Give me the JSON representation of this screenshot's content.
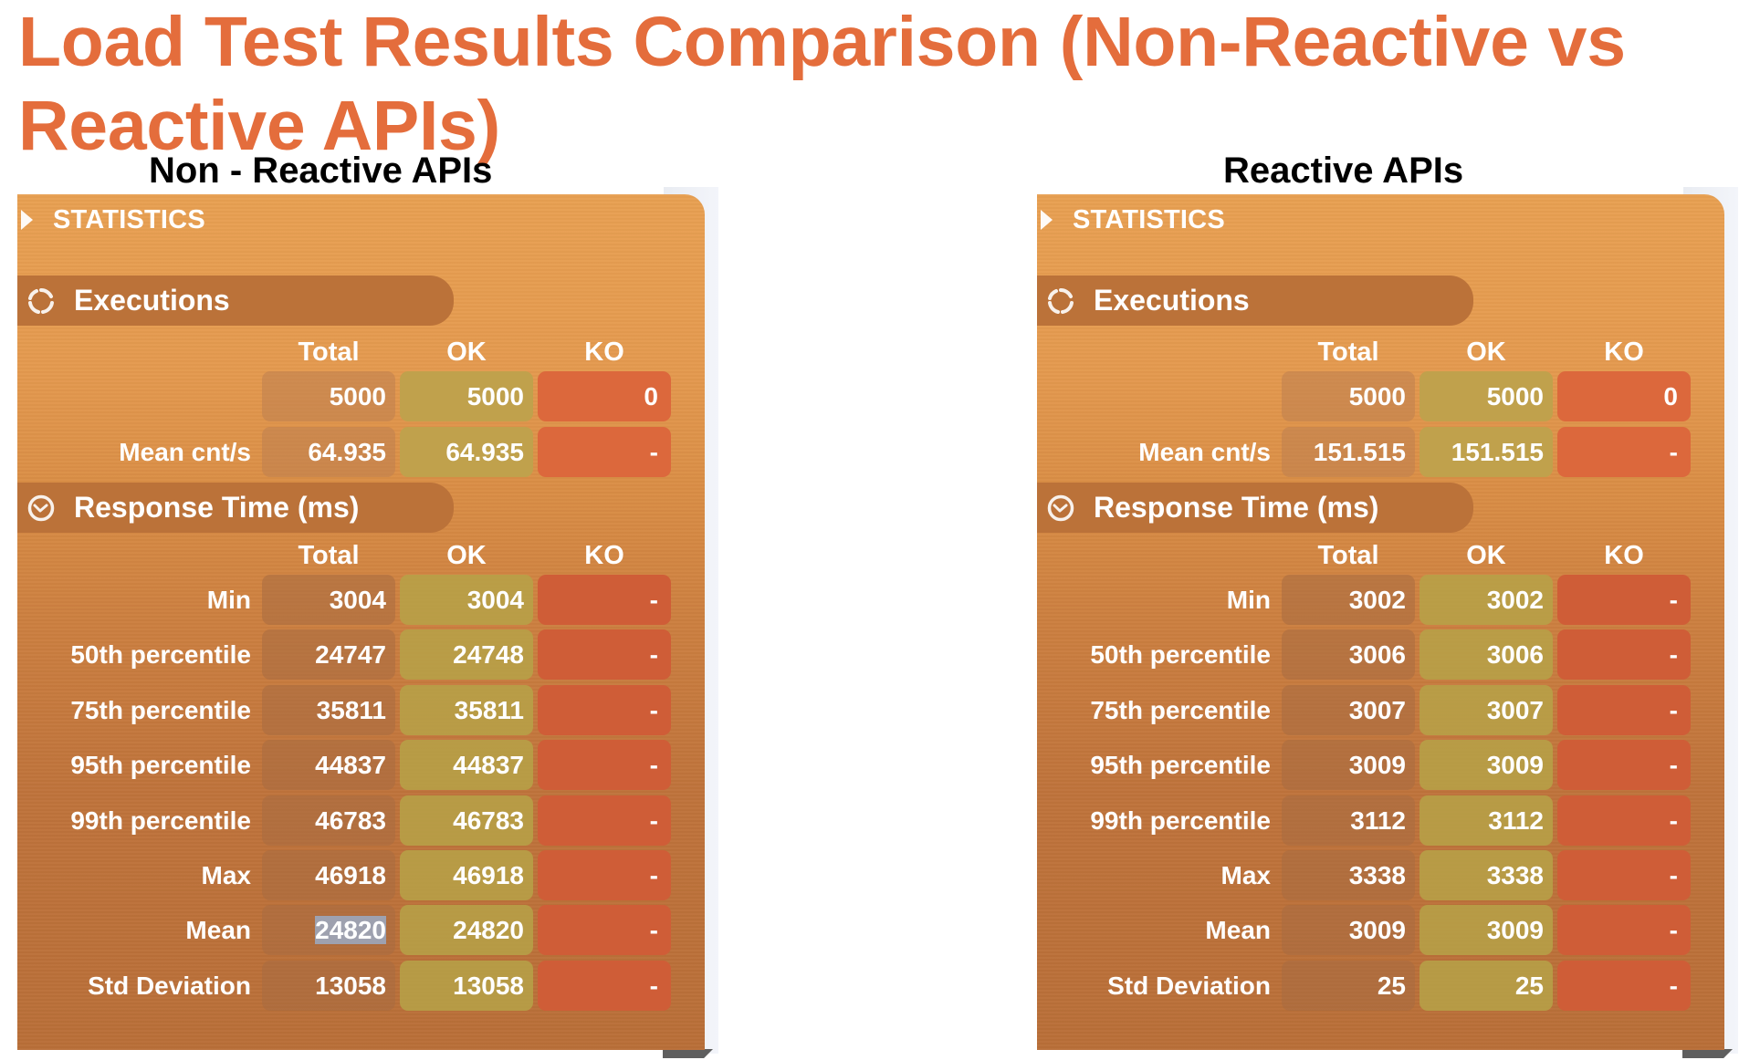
{
  "title": "Load Test Results Comparison (Non-Reactive vs Reactive APIs)",
  "panels": [
    {
      "heading": "Non - Reactive APIs",
      "statistics_label": "STATISTICS",
      "executions": {
        "label": "Executions",
        "columns": [
          "Total",
          "OK",
          "KO"
        ],
        "rows": [
          {
            "label": "",
            "total": "5000",
            "ok": "5000",
            "ko": "0"
          },
          {
            "label": "Mean cnt/s",
            "total": "64.935",
            "ok": "64.935",
            "ko": "-"
          }
        ]
      },
      "response_time": {
        "label": "Response Time (ms)",
        "columns": [
          "Total",
          "OK",
          "KO"
        ],
        "rows": [
          {
            "label": "Min",
            "total": "3004",
            "ok": "3004",
            "ko": "-"
          },
          {
            "label": "50th percentile",
            "total": "24747",
            "ok": "24748",
            "ko": "-"
          },
          {
            "label": "75th percentile",
            "total": "35811",
            "ok": "35811",
            "ko": "-"
          },
          {
            "label": "95th percentile",
            "total": "44837",
            "ok": "44837",
            "ko": "-"
          },
          {
            "label": "99th percentile",
            "total": "46783",
            "ok": "46783",
            "ko": "-"
          },
          {
            "label": "Max",
            "total": "46918",
            "ok": "46918",
            "ko": "-"
          },
          {
            "label": "Mean",
            "total": "24820",
            "ok": "24820",
            "ko": "-",
            "total_selected": true
          },
          {
            "label": "Std Deviation",
            "total": "13058",
            "ok": "13058",
            "ko": "-"
          }
        ]
      }
    },
    {
      "heading": "Reactive APIs",
      "statistics_label": "STATISTICS",
      "executions": {
        "label": "Executions",
        "columns": [
          "Total",
          "OK",
          "KO"
        ],
        "rows": [
          {
            "label": "",
            "total": "5000",
            "ok": "5000",
            "ko": "0"
          },
          {
            "label": "Mean cnt/s",
            "total": "151.515",
            "ok": "151.515",
            "ko": "-"
          }
        ]
      },
      "response_time": {
        "label": "Response Time (ms)",
        "columns": [
          "Total",
          "OK",
          "KO"
        ],
        "rows": [
          {
            "label": "Min",
            "total": "3002",
            "ok": "3002",
            "ko": "-"
          },
          {
            "label": "50th percentile",
            "total": "3006",
            "ok": "3006",
            "ko": "-"
          },
          {
            "label": "75th percentile",
            "total": "3007",
            "ok": "3007",
            "ko": "-"
          },
          {
            "label": "95th percentile",
            "total": "3009",
            "ok": "3009",
            "ko": "-"
          },
          {
            "label": "99th percentile",
            "total": "3112",
            "ok": "3112",
            "ko": "-"
          },
          {
            "label": "Max",
            "total": "3338",
            "ok": "3338",
            "ko": "-"
          },
          {
            "label": "Mean",
            "total": "3009",
            "ok": "3009",
            "ko": "-"
          },
          {
            "label": "Std Deviation",
            "total": "25",
            "ok": "25",
            "ko": "-"
          }
        ]
      }
    }
  ],
  "icons": {
    "statistics": "triangle-right-icon",
    "executions": "refresh-cycle-icon",
    "response_time": "clock-icon"
  },
  "colors": {
    "title": "#e46d3c",
    "panel_top": "#e8a052",
    "panel_bottom": "#b96f38",
    "section_bar": "#bb7239",
    "cell_ok": "#c0a14c",
    "cell_ko": "#dc683c"
  }
}
